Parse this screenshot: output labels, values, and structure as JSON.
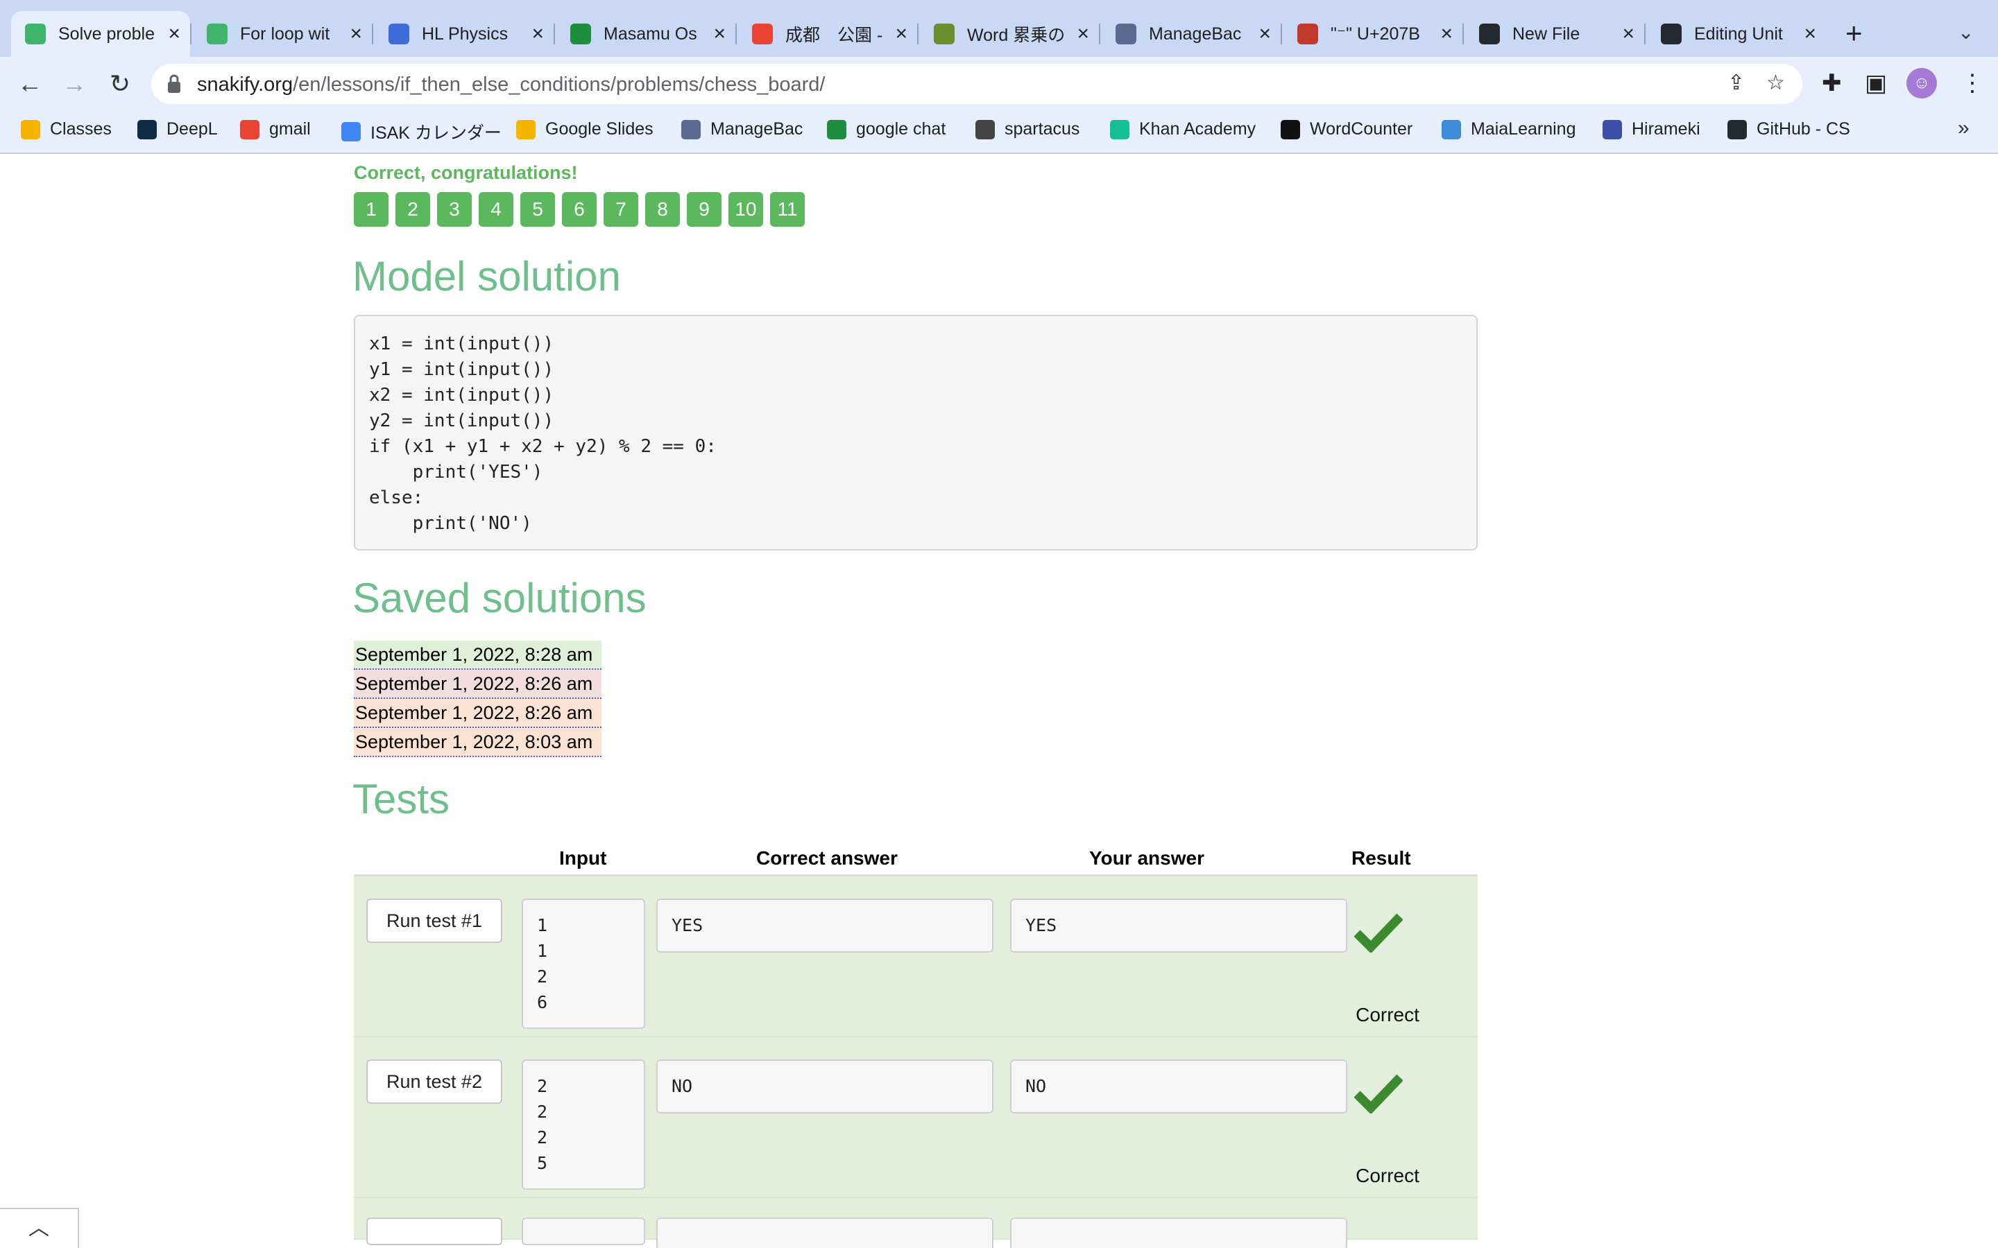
{
  "browser": {
    "tabs": [
      {
        "title": "Solve proble",
        "icon": "snakify-icon",
        "color": "#3fb56b"
      },
      {
        "title": "For loop wit",
        "icon": "snakify-icon",
        "color": "#3fb56b"
      },
      {
        "title": "HL Physics",
        "icon": "classroom-icon",
        "color": "#3d6cd8"
      },
      {
        "title": "Masamu Os",
        "icon": "sheets-icon",
        "color": "#1e8e3e"
      },
      {
        "title": "成都　公園 -",
        "icon": "maps-pin-icon",
        "color": "#ea4335"
      },
      {
        "title": "Word 累乗の",
        "icon": "word-icon",
        "color": "#6a8f2e"
      },
      {
        "title": "ManageBac",
        "icon": "managebac-icon",
        "color": "#5a6a90"
      },
      {
        "title": "\"⁻\" U+207B",
        "icon": "unicode-icon",
        "color": "#c0392b"
      },
      {
        "title": "New File",
        "icon": "github-icon",
        "color": "#24292f"
      },
      {
        "title": "Editing Unit",
        "icon": "github-icon",
        "color": "#24292f"
      }
    ],
    "url_host": "snakify.org",
    "url_path": "/en/lessons/if_then_else_conditions/problems/chess_board/",
    "bookmarks": [
      {
        "label": "Classes",
        "icon": "classroom-icon",
        "color": "#f4b400"
      },
      {
        "label": "DeepL",
        "icon": "deepl-icon",
        "color": "#0f2b46"
      },
      {
        "label": "gmail",
        "icon": "gmail-icon",
        "color": "#ea4335"
      },
      {
        "label": "ISAK カレンダー",
        "icon": "calendar-icon",
        "color": "#4285f4"
      },
      {
        "label": "Google Slides",
        "icon": "slides-icon",
        "color": "#f4b400"
      },
      {
        "label": "ManageBac",
        "icon": "managebac-icon",
        "color": "#5a6a90"
      },
      {
        "label": "google chat",
        "icon": "chat-icon",
        "color": "#1e8e3e"
      },
      {
        "label": "spartacus",
        "icon": "spartacus-icon",
        "color": "#444444"
      },
      {
        "label": "Khan Academy",
        "icon": "khan-icon",
        "color": "#14bf96"
      },
      {
        "label": "WordCounter",
        "icon": "wordcounter-icon",
        "color": "#111111"
      },
      {
        "label": "MaiaLearning",
        "icon": "maia-icon",
        "color": "#3d8bd8"
      },
      {
        "label": "Hirameki",
        "icon": "hirameki-icon",
        "color": "#3b4fa8"
      },
      {
        "label": "GitHub - CS",
        "icon": "github-icon",
        "color": "#24292f"
      }
    ]
  },
  "page": {
    "congrats": "Correct, congratulations!",
    "attempts": [
      "1",
      "2",
      "3",
      "4",
      "5",
      "6",
      "7",
      "8",
      "9",
      "10",
      "11"
    ],
    "model_solution_heading": "Model solution",
    "model_solution_code": "x1 = int(input())\ny1 = int(input())\nx2 = int(input())\ny2 = int(input())\nif (x1 + y1 + x2 + y2) % 2 == 0:\n    print('YES')\nelse:\n    print('NO')",
    "saved_heading": "Saved solutions",
    "saved": [
      {
        "label": "September 1, 2022, 8:28 am",
        "status": "ok"
      },
      {
        "label": "September 1, 2022, 8:26 am",
        "status": "bad"
      },
      {
        "label": "September 1, 2022, 8:26 am",
        "status": "fail"
      },
      {
        "label": "September 1, 2022, 8:03 am",
        "status": "fail"
      }
    ],
    "tests_heading": "Tests",
    "tests_columns": {
      "input": "Input",
      "correct": "Correct answer",
      "yours": "Your answer",
      "result": "Result"
    },
    "tests": [
      {
        "run_label": "Run test #1",
        "input": "1\n1\n2\n6",
        "correct": "YES",
        "yours": "YES",
        "result": "Correct"
      },
      {
        "run_label": "Run test #2",
        "input": "2\n2\n2\n5",
        "correct": "NO",
        "yours": "NO",
        "result": "Correct"
      }
    ]
  },
  "colors": {
    "accent": "#6fbf8c",
    "success": "#5cb85c",
    "row_ok": "#e3efdc",
    "check": "#3c8a2e"
  }
}
